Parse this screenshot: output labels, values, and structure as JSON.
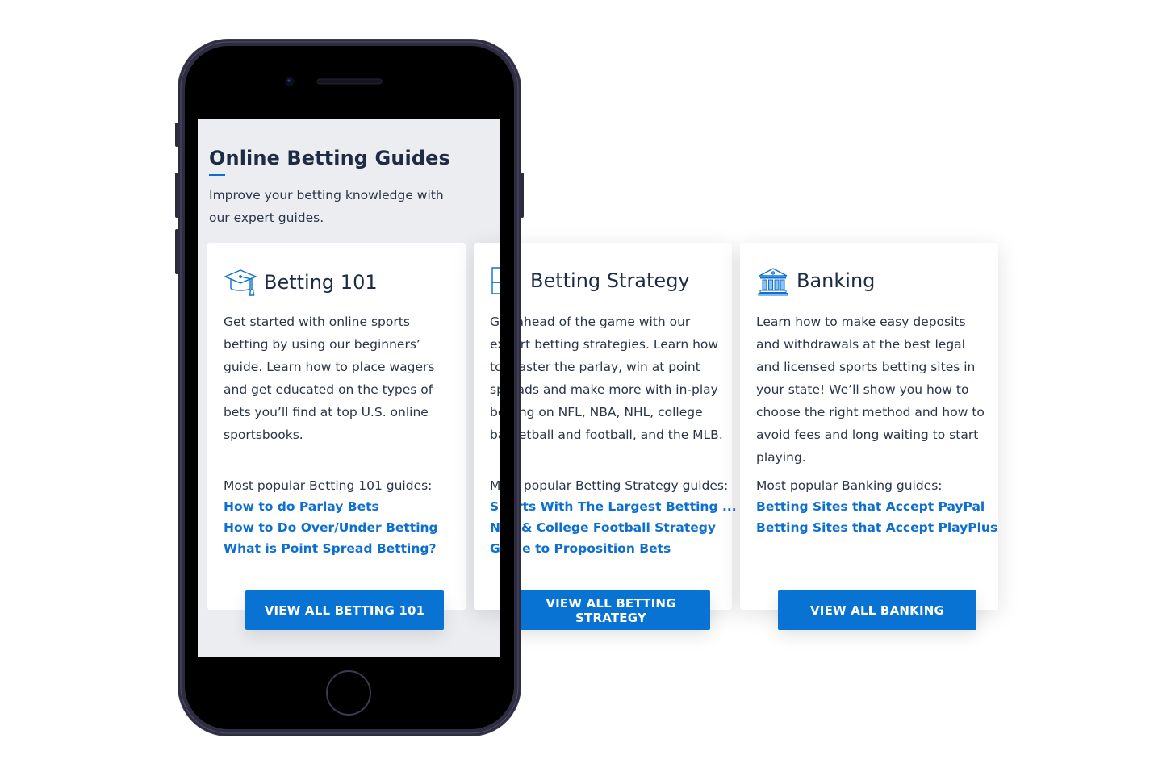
{
  "header": {
    "title": "Online Betting Guides",
    "subtitle": "Improve your betting knowledge with our expert guides."
  },
  "colors": {
    "accent": "#0873d2",
    "link": "#0d6fd0",
    "heading": "#1d2b44",
    "screen_bg": "#ebedf0"
  },
  "cards": [
    {
      "icon": "graduation-cap-icon",
      "title": "Betting 101",
      "description": "Get started with online sports betting by using our beginners’ guide. Learn how to place wagers and get educated on the types of bets you’ll find at top U.S. online sportsbooks.",
      "popular_label": "Most popular Betting 101 guides:",
      "links": [
        "How to do Parlay Bets",
        "How to Do Over/Under Betting",
        "What is Point Spread Betting?"
      ],
      "button": "VIEW ALL BETTING 101"
    },
    {
      "icon": "puzzle-icon",
      "title": "Betting Strategy",
      "description": "Get ahead of the game with our expert betting strategies. Learn how to master the parlay, win at point spreads and make more with in-play betting on NFL, NBA, NHL, college basketball and football, and the MLB.",
      "popular_label": "Most popular Betting Strategy guides:",
      "links": [
        "Sports With The Largest Betting ...",
        "NFL & College Football Strategy",
        "Guide to Proposition Bets"
      ],
      "button": "VIEW ALL BETTING STRATEGY"
    },
    {
      "icon": "bank-icon",
      "title": "Banking",
      "description": "Learn how to make easy deposits and withdrawals at the best legal and licensed sports betting sites in your state! We’ll show you how to choose the right method and how to avoid fees and long waiting to start playing.",
      "popular_label": "Most popular Banking guides:",
      "links": [
        "Betting Sites that Accept PayPal",
        "Betting Sites that Accept PlayPlus"
      ],
      "button": "VIEW ALL BANKING"
    }
  ]
}
